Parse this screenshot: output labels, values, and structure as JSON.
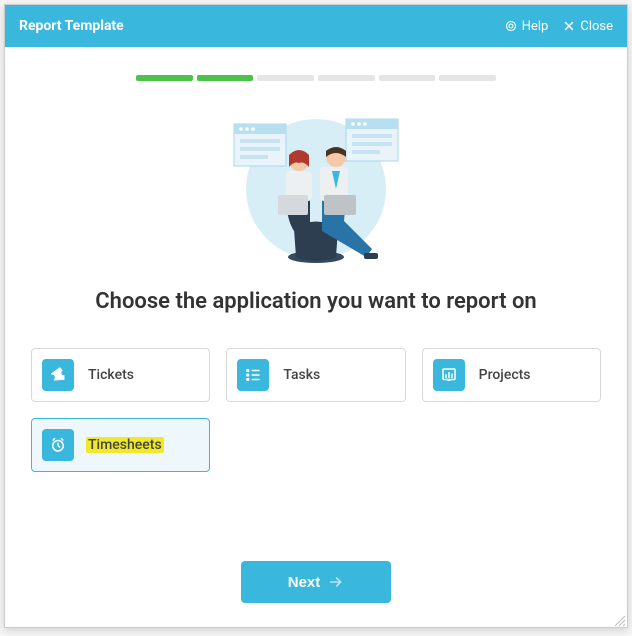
{
  "header": {
    "title": "Report Template",
    "help_label": "Help",
    "close_label": "Close"
  },
  "progress": {
    "steps_total": 6,
    "steps_done": 2
  },
  "heading": "Choose the application you want to report on",
  "options": [
    {
      "id": "tickets",
      "label": "Tickets",
      "icon": "ticket-icon",
      "selected": false,
      "highlighted": false
    },
    {
      "id": "tasks",
      "label": "Tasks",
      "icon": "tasks-icon",
      "selected": false,
      "highlighted": false
    },
    {
      "id": "projects",
      "label": "Projects",
      "icon": "projects-icon",
      "selected": false,
      "highlighted": false
    },
    {
      "id": "timesheets",
      "label": "Timesheets",
      "icon": "clock-icon",
      "selected": true,
      "highlighted": true
    }
  ],
  "footer": {
    "next_label": "Next"
  }
}
